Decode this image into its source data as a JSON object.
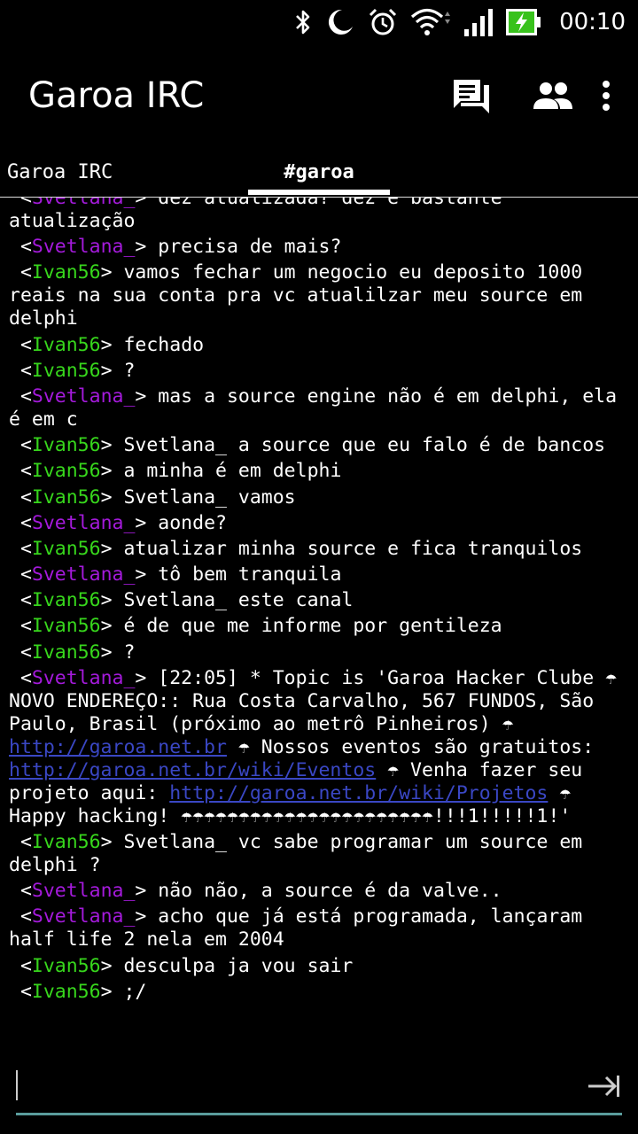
{
  "status_bar": {
    "time": "00:10"
  },
  "app": {
    "title": "Garoa IRC"
  },
  "tabs": [
    {
      "label": "Garoa IRC"
    },
    {
      "label": "#garoa"
    }
  ],
  "messages": [
    {
      "nick": "Svetlana_",
      "color": "#a41adb",
      "text": "dez atualizada? dez é bastante atualização"
    },
    {
      "nick": "Svetlana_",
      "color": "#a41adb",
      "text": "precisa de mais?"
    },
    {
      "nick": "Ivan56",
      "color": "#37d61c",
      "text": "vamos fechar um negocio eu deposito 1000 reais na sua conta pra vc atualilzar meu source em delphi"
    },
    {
      "nick": "Ivan56",
      "color": "#37d61c",
      "text": "fechado"
    },
    {
      "nick": "Ivan56",
      "color": "#37d61c",
      "text": "?"
    },
    {
      "nick": "Svetlana_",
      "color": "#a41adb",
      "text": "mas a source engine não é em delphi, ela é em c"
    },
    {
      "nick": "Ivan56",
      "color": "#37d61c",
      "text": "Svetlana_ a source que eu falo é de bancos"
    },
    {
      "nick": "Ivan56",
      "color": "#37d61c",
      "text": "a minha é em delphi"
    },
    {
      "nick": "Ivan56",
      "color": "#37d61c",
      "text": "Svetlana_ vamos"
    },
    {
      "nick": "Svetlana_",
      "color": "#a41adb",
      "text": "aonde?"
    },
    {
      "nick": "Ivan56",
      "color": "#37d61c",
      "text": "atualizar minha source e fica tranquilos"
    },
    {
      "nick": "Svetlana_",
      "color": "#a41adb",
      "text": "tô bem tranquila"
    },
    {
      "nick": "Ivan56",
      "color": "#37d61c",
      "text": "Svetlana_ este canal"
    },
    {
      "nick": "Ivan56",
      "color": "#37d61c",
      "text": "é de que me informe por gentileza"
    },
    {
      "nick": "Ivan56",
      "color": "#37d61c",
      "text": "?"
    },
    {
      "nick": "Svetlana_",
      "color": "#a41adb",
      "topic": {
        "t1": "[22:05] * Topic is 'Garoa Hacker Clube ☂ NOVO ENDEREÇO:: Rua Costa Carvalho, 567 FUNDOS, São Paulo, Brasil (próximo ao metrô Pinheiros) ☂ ",
        "link1": "http://garoa.net.br",
        "t2": " ☂ Nossos eventos são gratuitos: ",
        "link2": "http://garoa.net.br/wiki/Eventos",
        "t3": " ☂ Venha fazer seu projeto aqui: ",
        "link3": "http://garoa.net.br/wiki/Projetos",
        "t4": " ☂ Happy hacking! ☂☂☂☂☂☂☂☂☂☂☂☂☂☂☂☂☂☂☂☂☂☂!!!1!!!!!1!'"
      }
    },
    {
      "nick": "Ivan56",
      "color": "#37d61c",
      "text": "Svetlana_ vc sabe programar um source em delphi ?"
    },
    {
      "nick": "Svetlana_",
      "color": "#a41adb",
      "text": "não não, a source é da valve.."
    },
    {
      "nick": "Svetlana_",
      "color": "#a41adb",
      "text": "acho que já está programada, lançaram half life 2 nela em 2004"
    },
    {
      "nick": "Ivan56",
      "color": "#37d61c",
      "text": "desculpa ja vou sair"
    },
    {
      "nick": "Ivan56",
      "color": "#37d61c",
      "text": ";/"
    }
  ],
  "input": {
    "value": "",
    "placeholder": ""
  },
  "icons": {
    "status": [
      "bluetooth-icon",
      "moon-icon",
      "alarm-icon",
      "wifi-icon",
      "signal-icon",
      "battery-charging-icon"
    ],
    "actions": [
      "chat-icon",
      "users-icon",
      "more-vert-icon"
    ],
    "send": "send-tab-icon"
  }
}
